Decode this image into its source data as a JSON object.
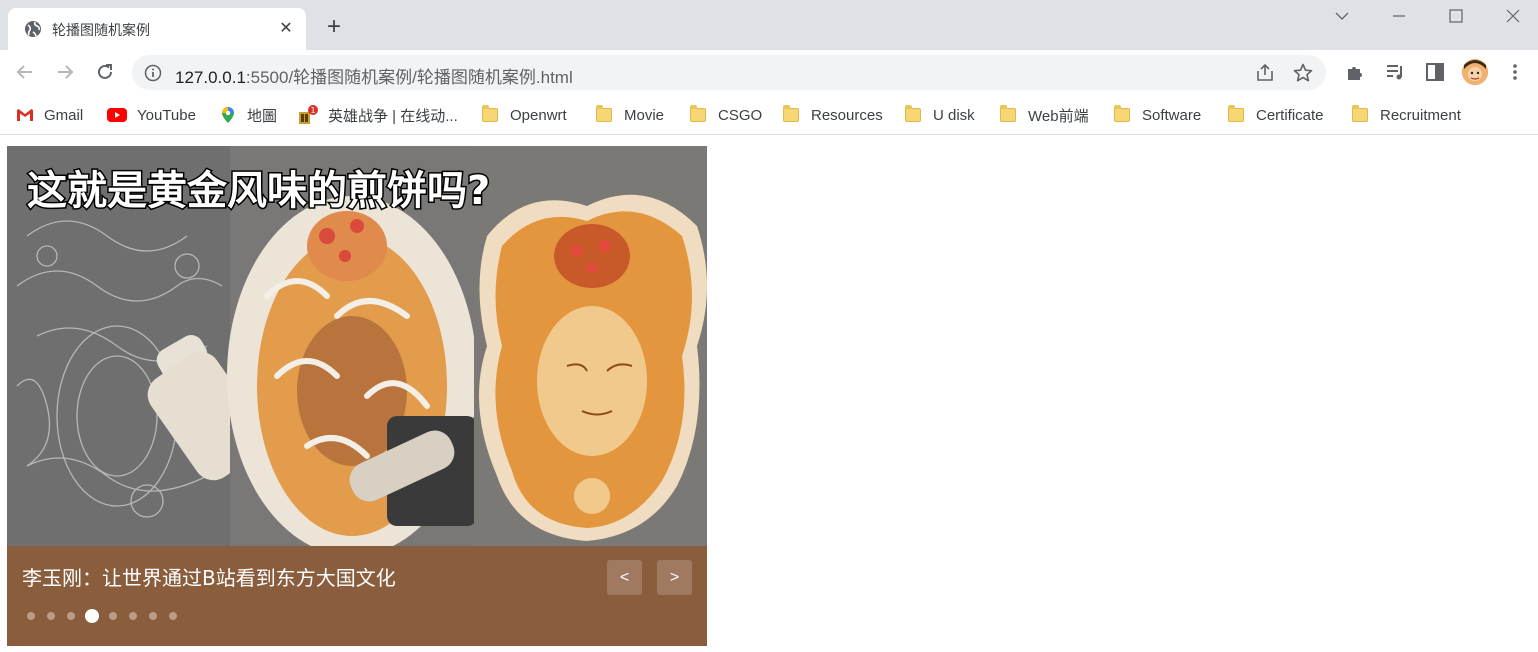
{
  "browser": {
    "tab_title": "轮播图随机案例",
    "url_host": "127.0.0.1",
    "url_rest": ":5500/轮播图随机案例/轮播图随机案例.html"
  },
  "bookmarks": [
    {
      "label": "Gmail",
      "icon": "gmail-icon"
    },
    {
      "label": "YouTube",
      "icon": "youtube-icon"
    },
    {
      "label": "地圖",
      "icon": "maps-icon"
    },
    {
      "label": "英雄战争 | 在线动...",
      "icon": "game-icon"
    },
    {
      "label": "Openwrt",
      "icon": "folder-icon"
    },
    {
      "label": "Movie",
      "icon": "folder-icon"
    },
    {
      "label": "CSGO",
      "icon": "folder-icon"
    },
    {
      "label": "Resources",
      "icon": "folder-icon"
    },
    {
      "label": "U disk",
      "icon": "folder-icon"
    },
    {
      "label": "Web前端",
      "icon": "folder-icon"
    },
    {
      "label": "Software",
      "icon": "folder-icon"
    },
    {
      "label": "Certificate",
      "icon": "folder-icon"
    },
    {
      "label": "Recruitment",
      "icon": "folder-icon"
    }
  ],
  "carousel": {
    "image_headline": "这就是黄金风味的煎饼吗?",
    "caption": "李玉刚：让世界通过B站看到东方大国文化",
    "prev_label": "<",
    "next_label": ">",
    "dot_count": 8,
    "active_index": 3,
    "footer_color": "#8a5d3d"
  }
}
